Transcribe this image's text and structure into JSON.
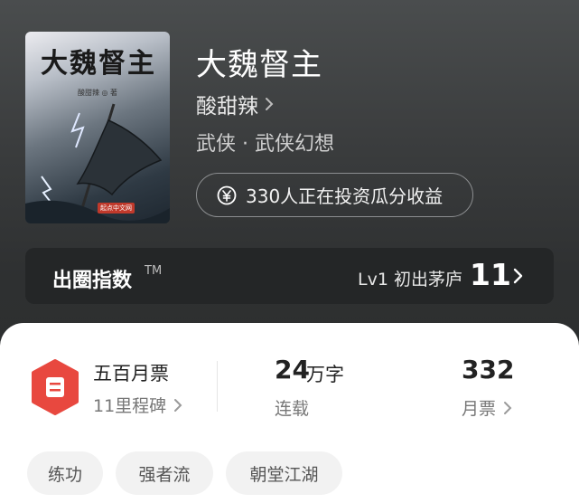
{
  "book": {
    "cover": {
      "title": "大魏督主",
      "author_line": "酸甜辣 ◎ 著",
      "publisher_logo": "起点中文网"
    },
    "title": "大魏督主",
    "author": "酸甜辣",
    "genre": "武侠 · 武侠幻想",
    "invest_text": "330人正在投资瓜分收益",
    "invest_icon": "yen-coin-icon"
  },
  "fame": {
    "title": "出圈指数",
    "tm": "TM",
    "level": "Lv1 初出茅庐",
    "score": "11"
  },
  "stats": {
    "rank_title": "五百月票",
    "rank_sub": "11里程碑",
    "words_num": "24",
    "words_unit": "万字",
    "words_label": "连载",
    "tickets_num": "332",
    "tickets_label": "月票"
  },
  "tags": [
    "练功",
    "强者流",
    "朝堂江湖"
  ],
  "colors": {
    "badge_red": "#e8483f",
    "header_bg": "#3a3c3d",
    "panel_bg": "#ffffff"
  }
}
